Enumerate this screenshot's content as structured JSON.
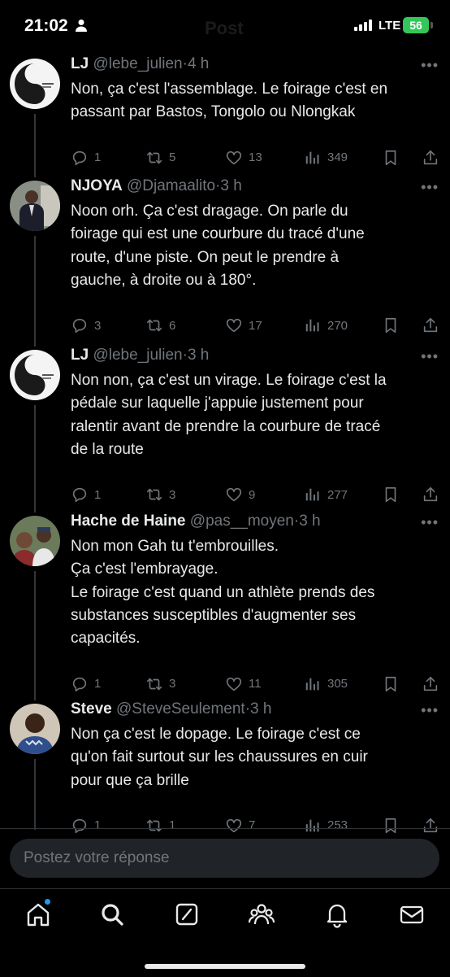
{
  "status_bar": {
    "time": "21:02",
    "network": "LTE",
    "battery": "56",
    "header_title": "Post"
  },
  "tweets": [
    {
      "name": "LJ",
      "handle": "@lebe_julien",
      "time": "4 h",
      "lines": [
        "Non, ça c'est l'assemblage. Le foirage c'est en",
        "passant par Bastos, Tongolo ou Nlongkak"
      ],
      "replies": "1",
      "reposts": "5",
      "likes": "13",
      "views": "349"
    },
    {
      "name": "NJOYA",
      "handle": "@Djamaalito",
      "time": "3 h",
      "lines": [
        "Noon orh. Ça c'est dragage. On parle du",
        "foirage qui est une courbure du tracé d'une",
        "route, d'une piste. On peut le prendre à",
        "gauche, à droite ou à 180°."
      ],
      "replies": "3",
      "reposts": "6",
      "likes": "17",
      "views": "270"
    },
    {
      "name": "LJ",
      "handle": "@lebe_julien",
      "time": "3 h",
      "lines": [
        "Non non, ça c'est un virage. Le foirage c'est la",
        "pédale sur laquelle j'appuie justement pour",
        "ralentir avant de prendre la courbure de tracé",
        "de la route"
      ],
      "replies": "1",
      "reposts": "3",
      "likes": "9",
      "views": "277"
    },
    {
      "name": "Hache de Haine",
      "handle": "@pas__moyen",
      "time": "3 h",
      "lines": [
        "Non mon Gah tu t'embrouilles.",
        "Ça c'est l'embrayage.",
        "Le foirage c'est quand un athlète prends des",
        "substances susceptibles d'augmenter ses",
        "capacités."
      ],
      "replies": "1",
      "reposts": "3",
      "likes": "11",
      "views": "305"
    },
    {
      "name": "Steve",
      "handle": "@SteveSeulement",
      "time": "3 h",
      "lines": [
        "Non ça c'est le dopage. Le foirage c'est ce",
        "qu'on fait surtout sur les chaussures en cuir",
        "pour que ça brille"
      ],
      "replies": "1",
      "reposts": "1",
      "likes": "7",
      "views": "253"
    }
  ],
  "reply_bar": {
    "placeholder": "Postez votre réponse"
  },
  "tabs": [
    "home-icon",
    "search-icon",
    "grok-icon",
    "communities-icon",
    "notifications-icon",
    "messages-icon"
  ],
  "colors": {
    "background": "#000000",
    "text": "#e7e9ea",
    "muted": "#71767b",
    "accent": "#1d9bf0",
    "battery": "#33c759"
  }
}
